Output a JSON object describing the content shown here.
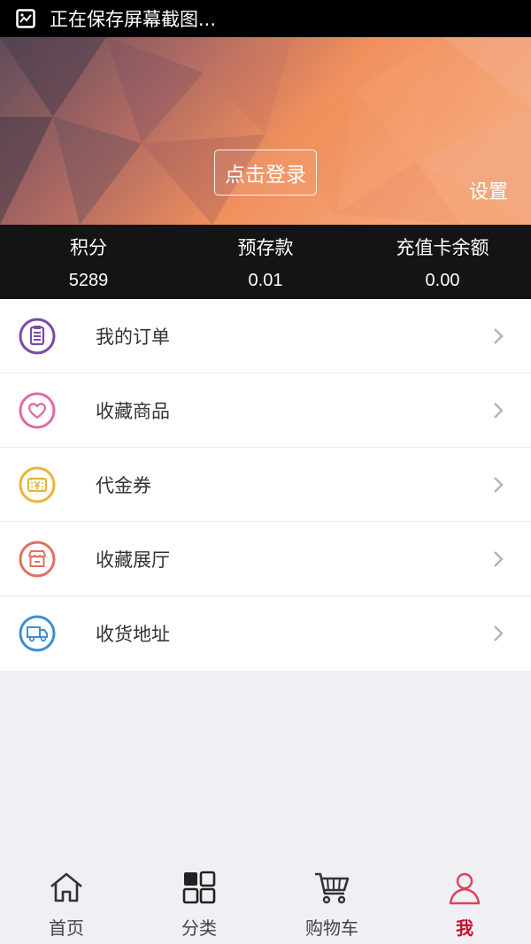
{
  "status_bar": {
    "text": "正在保存屏幕截图..."
  },
  "header": {
    "login_button": "点击登录",
    "settings": "设置"
  },
  "stats": [
    {
      "label": "积分",
      "value": "5289"
    },
    {
      "label": "预存款",
      "value": "0.01"
    },
    {
      "label": "充值卡余额",
      "value": "0.00"
    }
  ],
  "menu": [
    {
      "label": "我的订单",
      "icon": "order-list-icon",
      "color": "#7b4aa8"
    },
    {
      "label": "收藏商品",
      "icon": "heart-icon",
      "color": "#e06aa9"
    },
    {
      "label": "代金券",
      "icon": "coupon-icon",
      "color": "#e8b53a"
    },
    {
      "label": "收藏展厅",
      "icon": "shop-icon",
      "color": "#e0705f"
    },
    {
      "label": "收货地址",
      "icon": "delivery-truck-icon",
      "color": "#3c8fd0"
    }
  ],
  "tabs": [
    {
      "label": "首页",
      "icon": "home-icon"
    },
    {
      "label": "分类",
      "icon": "category-grid-icon"
    },
    {
      "label": "购物车",
      "icon": "cart-icon"
    },
    {
      "label": "我",
      "icon": "user-icon",
      "active": true
    }
  ],
  "colors": {
    "accent": "#c8102e",
    "stats_bg": "#141414"
  }
}
